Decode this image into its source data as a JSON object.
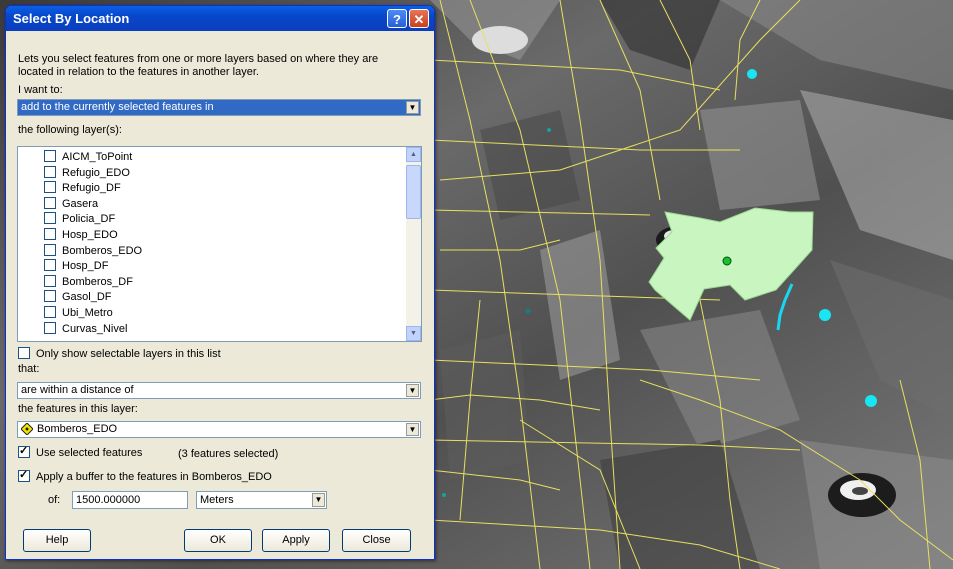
{
  "dialog": {
    "title": "Select By Location",
    "help_glyph": "?",
    "close_glyph": "✕",
    "description_line1": "Lets you select features from one or more layers based on where they are",
    "description_line2": "located in relation to the features in another layer.",
    "intent_label": "I want to:",
    "intent_value": "add to the currently selected features in",
    "layers_label": "the following layer(s):",
    "layers": [
      {
        "name": "AICM_ToPoint",
        "checked": false
      },
      {
        "name": "Refugio_EDO",
        "checked": false
      },
      {
        "name": "Refugio_DF",
        "checked": false
      },
      {
        "name": "Gasera",
        "checked": false
      },
      {
        "name": "Policia_DF",
        "checked": false
      },
      {
        "name": "Hosp_EDO",
        "checked": false
      },
      {
        "name": "Bomberos_EDO",
        "checked": false
      },
      {
        "name": "Hosp_DF",
        "checked": false
      },
      {
        "name": "Bomberos_DF",
        "checked": false
      },
      {
        "name": "Gasol_DF",
        "checked": false
      },
      {
        "name": "Ubi_Metro",
        "checked": false
      },
      {
        "name": "Curvas_Nivel",
        "checked": false
      }
    ],
    "only_selectable_label": "Only show selectable layers in this list",
    "only_selectable_checked": false,
    "that_label": "that:",
    "relation_value": "are within a distance of",
    "source_label": "the features in this layer:",
    "source_value": "Bomberos_EDO",
    "use_selected_label": "Use selected features",
    "use_selected_checked": true,
    "selected_count": "(3 features selected)",
    "buffer_label": "Apply a buffer to the features in Bomberos_EDO",
    "buffer_checked": true,
    "of_label": "of:",
    "buffer_distance": "1500.000000",
    "buffer_units": "Meters",
    "buttons": {
      "help": "Help",
      "ok": "OK",
      "apply": "Apply",
      "close": "Close"
    }
  },
  "map": {
    "colors": {
      "roads": "#e8e060",
      "selection_fill": "#c8f5c0",
      "point_cyan": "#19e6f5",
      "point_green": "#18c030",
      "line_cyan": "#19d6f0"
    }
  }
}
